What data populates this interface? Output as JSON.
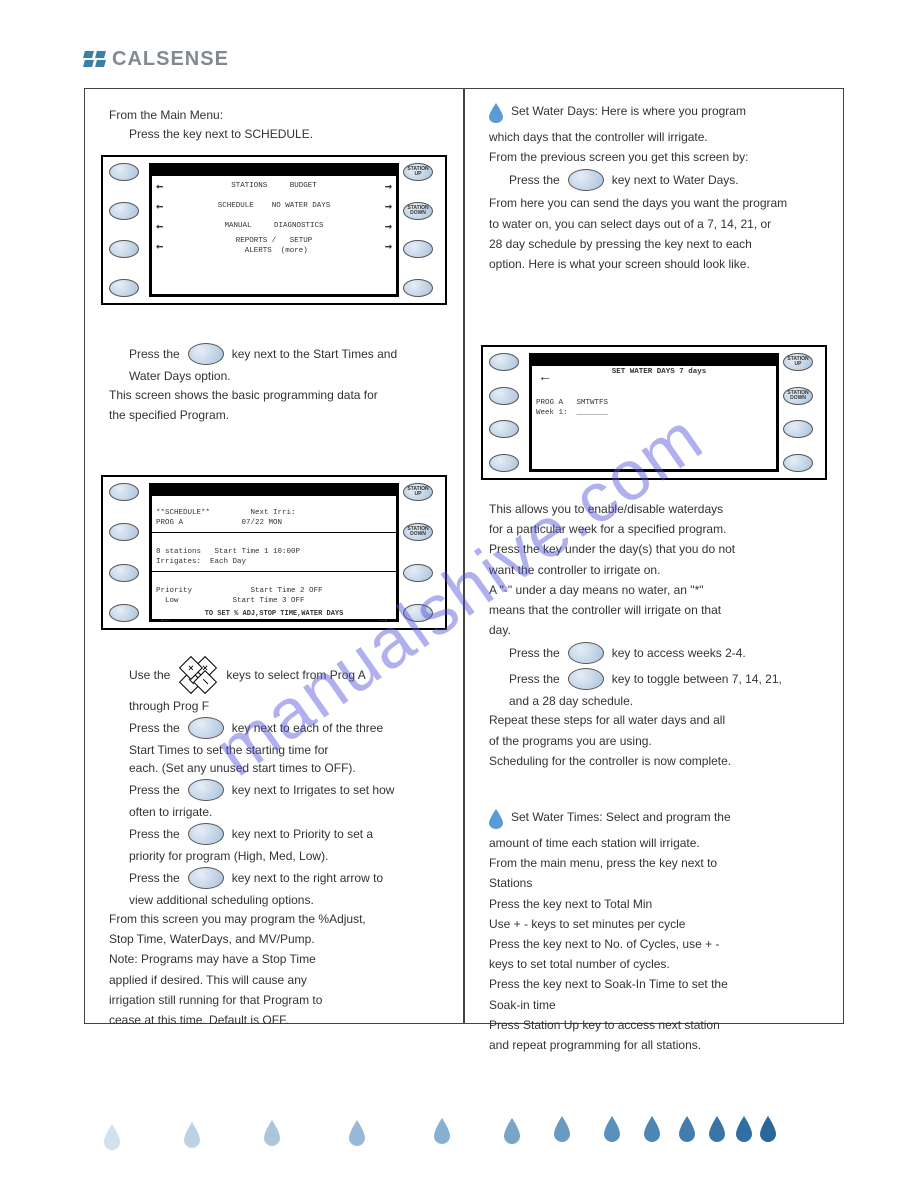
{
  "brand": "CALSENSE",
  "watermark": "manualshive.com",
  "left_col": {
    "intro_line1": "From the Main Menu:",
    "intro_line2": "Press the key next to SCHEDULE.",
    "panel_a": {
      "r1": {
        "left": "STATIONS",
        "right": "BUDGET"
      },
      "r2": {
        "left": "SCHEDULE",
        "right": "NO WATER DAYS"
      },
      "r3": {
        "left": "MANUAL",
        "right": "DIAGNOSTICS"
      },
      "r4a": {
        "left": "REPORTS /",
        "right": "SETUP"
      },
      "r4b": {
        "left": "  ALERTS",
        "right": "(more)"
      },
      "btn_up": "STATION UP",
      "btn_down": "STATION DOWN"
    },
    "after_a_txt1": "Press the",
    "after_a_key": "key next to the Start Times and",
    "after_a_txt2": "Water Days option.",
    "after_a_note": "This screen shows the basic programming data for",
    "after_a_note2": "the specified Program.",
    "panel_b": {
      "title": "**SCHEDULE**         Next Irri:",
      "line_a": "PROG A             07/22 MON",
      "line_b": "8 stations   Start Time 1 10:00P",
      "line_c": "Irrigates:  Each Day",
      "line_d1": "Priority             Start Time 2 OFF",
      "line_d2": "  Low            Start Time 3 OFF",
      "footer": "TO SET % ADJ,STOP TIME,WATER DAYS",
      "btn_up": "STATION UP",
      "btn_down": "STATION DOWN"
    },
    "b_use_plus": "Use the",
    "b_use_plus2": "keys to select from Prog A",
    "b_use_plus3": "through Prog F",
    "b_start": "Press the",
    "b_start2": "key next to each of the three",
    "b_start3": "Start Times to set the starting time for",
    "b_start4": "each. (Set any unused start times to OFF).",
    "b_irrig": "Press the",
    "b_irrig2": "key next to Irrigates to set how",
    "b_irrig3": "often to irrigate.",
    "b_prio": "Press the",
    "b_prio2": "key next to Priority to set a",
    "b_prio3": "priority for program (High, Med, Low).",
    "b_more1": "Press the",
    "b_more1b": "key next to the right arrow to",
    "b_more1c": "view additional scheduling options.",
    "b_more2": "From this screen you may program the %Adjust,",
    "b_more3": "Stop Time, WaterDays, and MV/Pump.",
    "b_note1": "Note: Programs may have a Stop Time",
    "b_note2": "applied if desired. This will cause any",
    "b_note3": "irrigation still running for that Program to",
    "b_note4": "cease at this time. Default is OFF."
  },
  "right_col": {
    "r1_lead": "Set Water Days: Here is where you program",
    "r1b": "which days that the controller will irrigate.",
    "r1c": "From the previous screen you get this screen by:",
    "r1_press": "Press the",
    "r1_press2": "key next to Water Days.",
    "r1_send": "From here you can send the days you want the program",
    "r1_send2": "to water on, you can select days out of a 7, 14, 21, or",
    "r1_send3": "28 day schedule by pressing the key next to each",
    "r1_send4": "option. Here is what your screen should look like.",
    "panel_c": {
      "title": "SET WATER DAYS       7 days",
      "line1": "PROG A   SMTWTFS",
      "line2": "Week 1:  _______",
      "btn_up": "STATION UP",
      "btn_down": "STATION DOWN"
    },
    "c_note1": "This allows you to enable/disable waterdays",
    "c_note2": "for a particular week for a specified program.",
    "c_note3": "Press the key under the day(s) that you do not",
    "c_note4": "want the controller to irrigate on.",
    "c_note5": "A \"-\" under a day means no water, an \"*\"",
    "c_note6": "means that the controller will irrigate on that",
    "c_note7": "day.",
    "c_more1": "Press the",
    "c_more1b": "key to access weeks 2-4.",
    "c_more2": "Press the",
    "c_more2b": "key to toggle between 7, 14, 21,",
    "c_more2c": "and a 28 day schedule.",
    "c_note8": "Repeat these steps for all water days and all",
    "c_note9": "of the programs you are using.",
    "c_note10": "Scheduling for the controller is now complete.",
    "sec2_lead": "Set Water Times: Select and program the",
    "sec2_b": "amount of time each station will irrigate.",
    "sec2_c": "From the main menu, press the key next to",
    "sec2_d": "Stations",
    "sec2_e": "Press the key next to Total Min",
    "sec2_f": "Use + - keys to set minutes per cycle",
    "sec2_g": "Press the key next to No. of Cycles, use + -",
    "sec2_h": "keys to set total number of cycles.",
    "sec2_i": "Press the key next to Soak-In Time to set the",
    "sec2_j": "Soak-in time",
    "sec2_k": "Press Station Up key to access next station",
    "sec2_l": "and repeat programming for all stations."
  }
}
